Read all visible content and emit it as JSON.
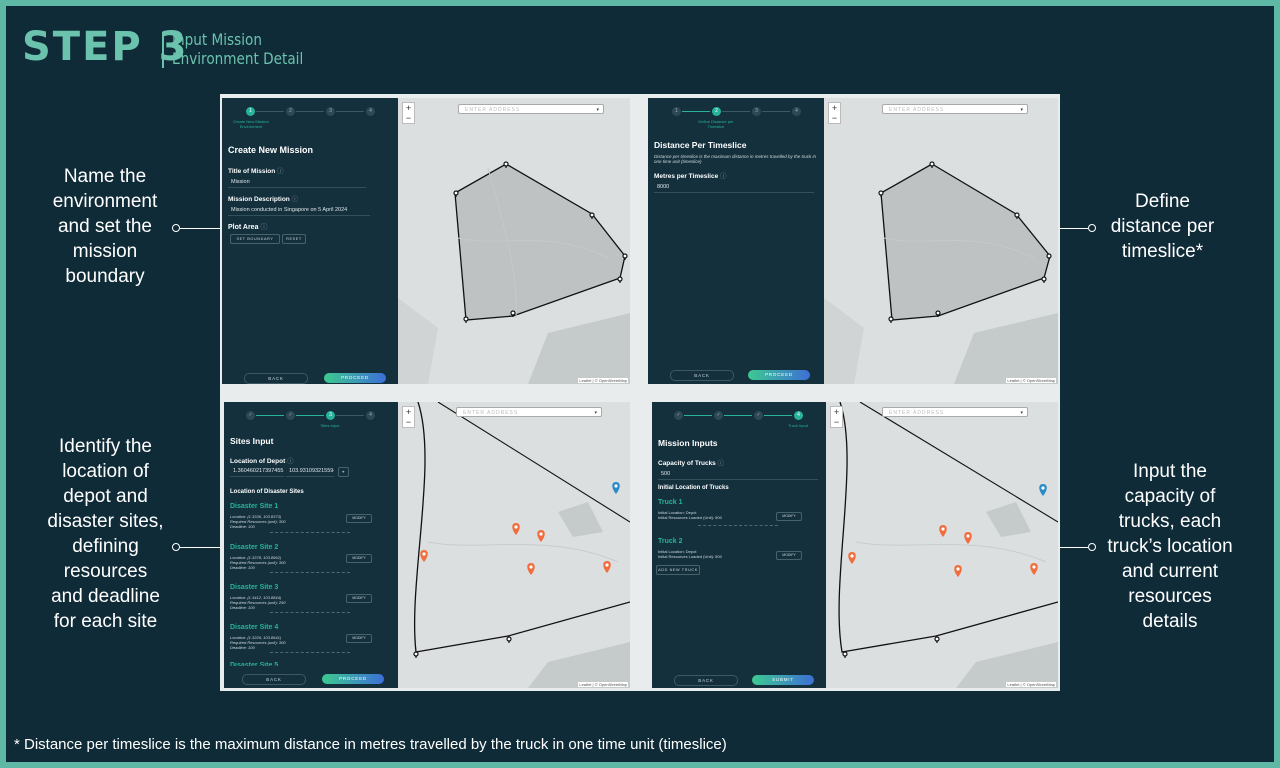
{
  "header": {
    "step": "STEP 3",
    "sub1": "Input Mission",
    "sub2": "Environment Detail"
  },
  "annotations": {
    "a1": [
      "Name the",
      "environment",
      "and set the",
      "mission",
      "boundary"
    ],
    "a2": [
      "Define",
      "distance per",
      "timeslice*"
    ],
    "a3": [
      "Identify the",
      "location of",
      "depot and",
      "disaster sites,",
      "defining",
      "resources",
      "and deadline",
      "for each site"
    ],
    "a4": [
      "Input the",
      "capacity of",
      "trucks, each",
      "truck’s location",
      "and current",
      "resources",
      "details"
    ]
  },
  "footnote": "* Distance per timeslice is the maximum distance in metres travelled by the truck in one time unit (timeslice)",
  "common": {
    "search_placeholder": "ENTER ADDRESS",
    "zoom_in": "+",
    "zoom_out": "−",
    "back": "BACK",
    "proceed": "PROCEED",
    "submit": "SUBMIT",
    "attribution": "Leaflet | © OpenStreetMap",
    "steps": [
      "1",
      "2",
      "3",
      "4"
    ]
  },
  "p1": {
    "step_label": "Create New Mission Environment",
    "title": "Create New Mission",
    "title_label": "Title of Mission",
    "title_value": "Mission",
    "desc_label": "Mission Description",
    "desc_value": "Mission conducted in Singapore on 5 April 2024",
    "plot_label": "Plot Area",
    "set_boundary": "SET BOUNDARY",
    "reset": "RESET"
  },
  "p2": {
    "step_label": "Define Distance per Timeslice",
    "title": "Distance Per Timeslice",
    "desc": "Distance per timeslice is the maximum distance in metres travelled by the truck in one time unit (timeslice)",
    "metres_label": "Metres per Timeslice",
    "metres_value": "8000"
  },
  "p3": {
    "step_label": "Sites Input",
    "title": "Sites Input",
    "depot_label": "Location of Depot",
    "depot_lat": "1.360460217397455",
    "depot_lng": "103.931093215594",
    "sites_label": "Location of Disaster Sites",
    "modify": "MODIFY",
    "sites": [
      {
        "name": "Disaster Site 1",
        "loc": "Location: (1.3336, 103.8373)",
        "res": "Required Resources (unit): 300",
        "dl": "Deadline: 100"
      },
      {
        "name": "Disaster Site 2",
        "loc": "Location: (1.3378, 103.8962)",
        "res": "Required Resources (unit): 300",
        "dl": "Deadline: 100"
      },
      {
        "name": "Disaster Site 3",
        "loc": "Location: (1.3412, 103.8844)",
        "res": "Required Resources (unit): 250",
        "dl": "Deadline: 100"
      },
      {
        "name": "Disaster Site 4",
        "loc": "Location: (1.3226, 103.8641)",
        "res": "Required Resources (unit): 300",
        "dl": "Deadline: 100"
      }
    ],
    "more": "Disaster Site 5"
  },
  "p4": {
    "step_label": "Truck Input",
    "title": "Mission Inputs",
    "cap_label": "Capacity of Trucks",
    "cap_value": "500",
    "init_label": "Initial Location of Trucks",
    "modify": "MODIFY",
    "add_truck": "ADD NEW TRUCK",
    "trucks": [
      {
        "name": "Truck 1",
        "loc": "Initial Location: Depot",
        "res": "Initial Resources Loaded (Unit): 500"
      },
      {
        "name": "Truck 2",
        "loc": "Initial Location: Depot",
        "res": "Initial Resources Loaded (Unit): 500"
      }
    ]
  },
  "colors": {
    "accent": "#6bc2ad",
    "teal": "#27b39a",
    "bg": "#0f2b38",
    "marker_orange": "#f26d3d",
    "marker_blue": "#2a8bc8"
  }
}
